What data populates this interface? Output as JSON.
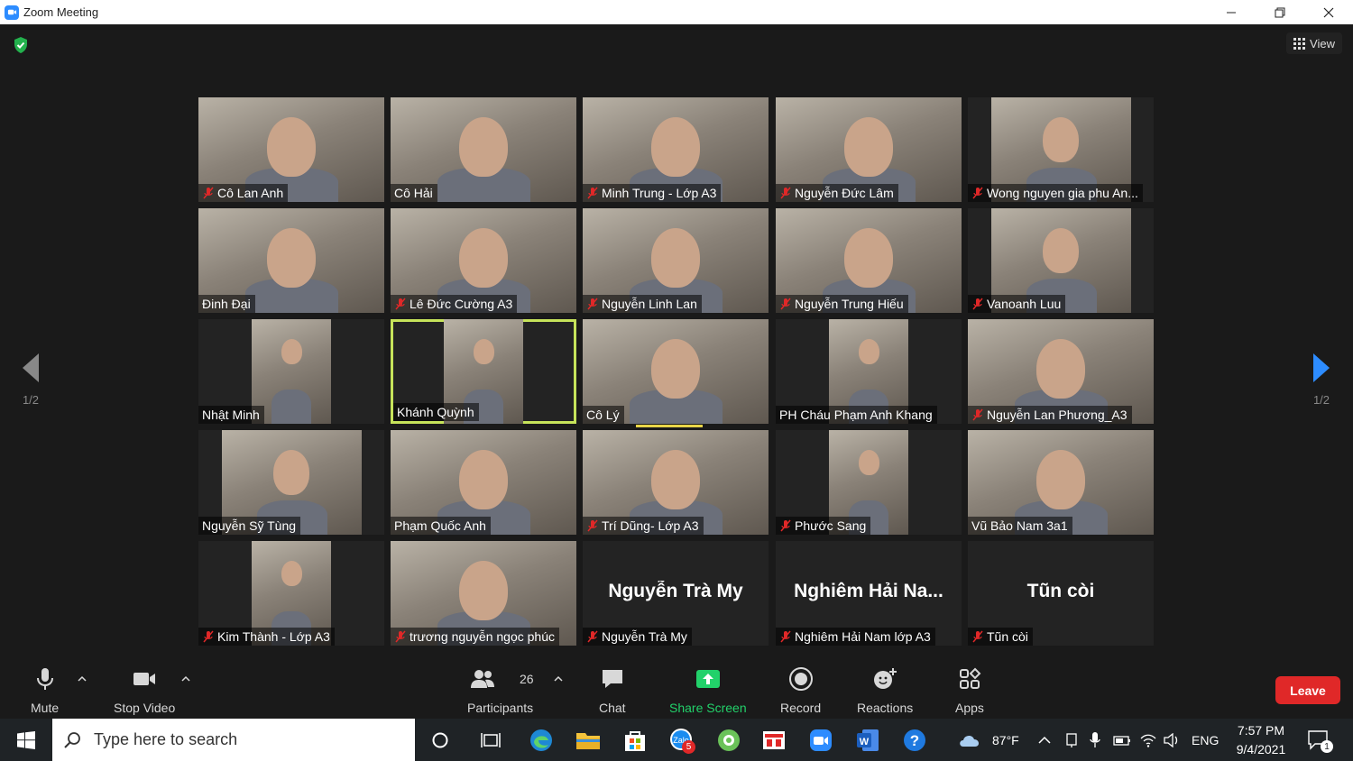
{
  "window": {
    "title": "Zoom Meeting"
  },
  "header": {
    "view_label": "View"
  },
  "pagination": {
    "left": "1/2",
    "right": "1/2"
  },
  "participants_grid": [
    {
      "name": "Cô Lan Anh",
      "muted": true,
      "video": "full"
    },
    {
      "name": "Cô  Hải",
      "muted": false,
      "video": "full"
    },
    {
      "name": "Minh Trung - Lớp A3",
      "muted": true,
      "video": "full"
    },
    {
      "name": "Nguyễn Đức Lâm",
      "muted": true,
      "video": "full"
    },
    {
      "name": "Wong nguyen gia phu An...",
      "muted": true,
      "video": "mid"
    },
    {
      "name": "Đinh Đại",
      "muted": false,
      "video": "full"
    },
    {
      "name": "Lê Đức Cường A3",
      "muted": true,
      "video": "full"
    },
    {
      "name": "Nguyễn Linh Lan",
      "muted": true,
      "video": "full"
    },
    {
      "name": "Nguyễn Trung Hiếu",
      "muted": true,
      "video": "full"
    },
    {
      "name": "Vanoanh Luu",
      "muted": true,
      "video": "mid"
    },
    {
      "name": "Nhật Minh",
      "muted": false,
      "video": "narrow"
    },
    {
      "name": "Khánh Quỳnh",
      "muted": false,
      "video": "narrow",
      "speaking": true
    },
    {
      "name": "Cô Lý",
      "muted": false,
      "video": "full"
    },
    {
      "name": "PH Cháu Phạm Anh Khang",
      "muted": false,
      "video": "narrow"
    },
    {
      "name": "Nguyễn Lan Phương_A3",
      "muted": true,
      "video": "full"
    },
    {
      "name": "Nguyễn Sỹ Tùng",
      "muted": false,
      "video": "mid"
    },
    {
      "name": "Phạm Quốc Anh",
      "muted": false,
      "video": "full"
    },
    {
      "name": "Trí Dũng- Lớp A3",
      "muted": true,
      "video": "full"
    },
    {
      "name": "Phước Sang",
      "muted": true,
      "video": "narrow"
    },
    {
      "name": "Vũ Bảo Nam 3a1",
      "muted": false,
      "video": "full"
    },
    {
      "name": "Kim Thành - Lớp A3",
      "muted": true,
      "video": "narrow"
    },
    {
      "name": "trương nguyễn ngọc phúc",
      "muted": true,
      "video": "full"
    },
    {
      "name": "Nguyễn Trà My",
      "muted": true,
      "video": "off",
      "display_name": "Nguyễn Trà My"
    },
    {
      "name": "Nghiêm Hải Nam lớp A3",
      "muted": true,
      "video": "off",
      "display_name": "Nghiêm  Hải  Na..."
    },
    {
      "name": "Tũn còi",
      "muted": true,
      "video": "off",
      "display_name": "Tũn còi"
    }
  ],
  "toolbar": {
    "mute": "Mute",
    "stop_video": "Stop Video",
    "participants": "Participants",
    "participants_count": "26",
    "chat": "Chat",
    "share_screen": "Share Screen",
    "record": "Record",
    "reactions": "Reactions",
    "apps": "Apps",
    "leave": "Leave"
  },
  "colors": {
    "accent": "#2d8cff",
    "leave": "#e02828",
    "share": "#22d16a",
    "speaker": "#c6e35a",
    "shield": "#23b14d"
  },
  "taskbar": {
    "search_placeholder": "Type here to search",
    "mail_badge": "5",
    "weather": "87°F",
    "language": "ENG",
    "time": "7:57 PM",
    "date": "9/4/2021",
    "notifications": "1"
  }
}
